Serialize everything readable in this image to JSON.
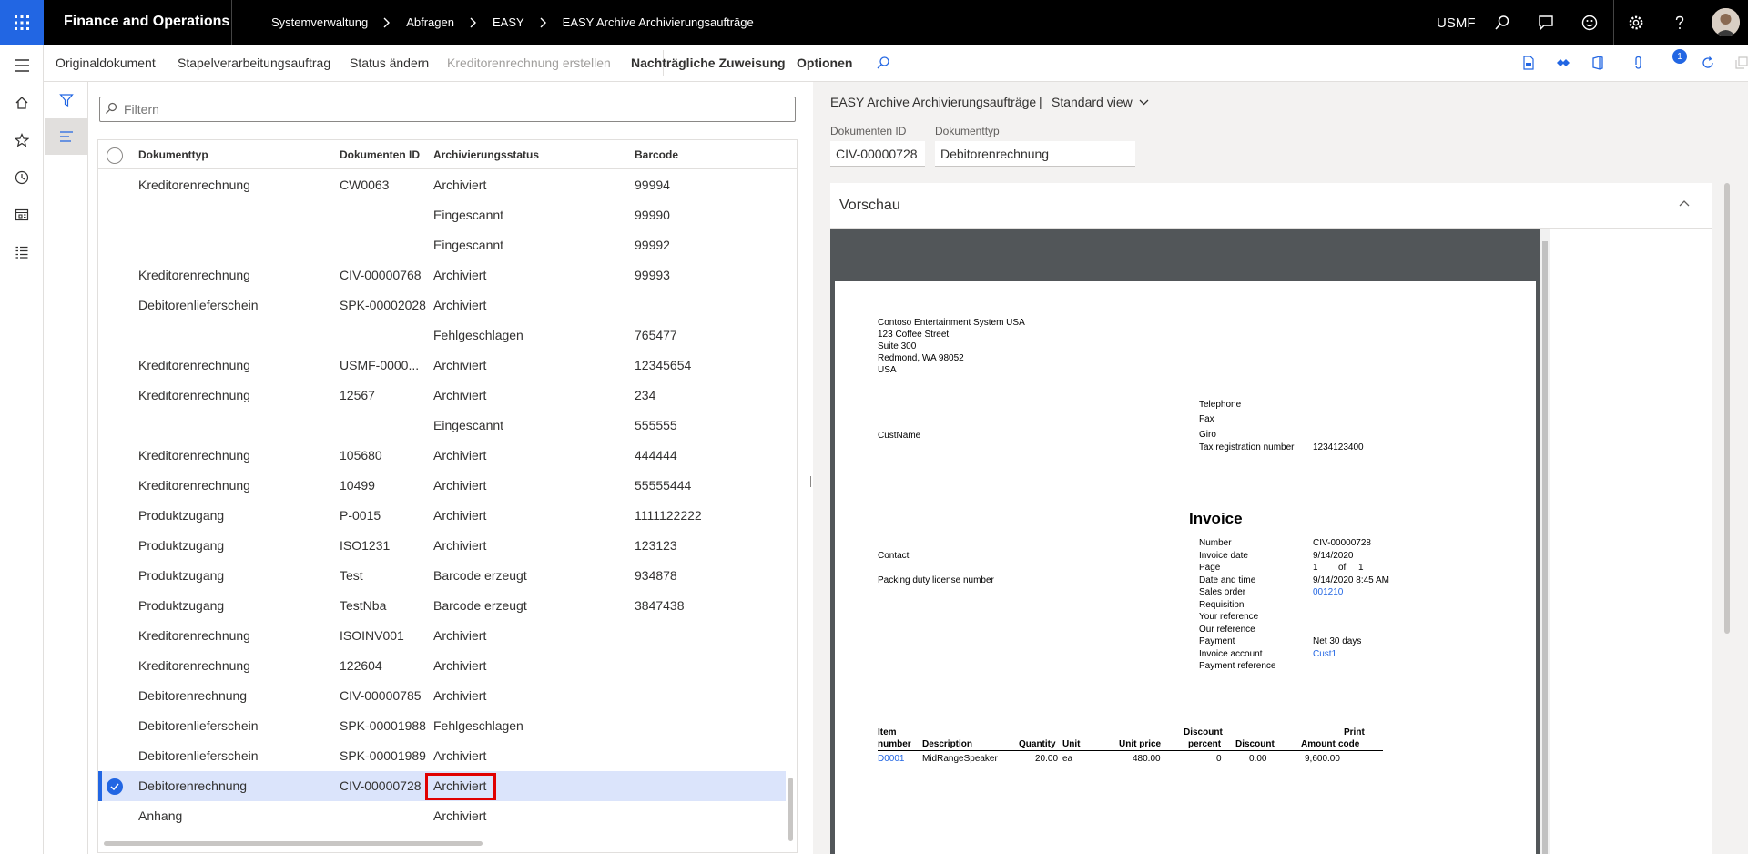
{
  "topbar": {
    "app_title": "Finance and Operations",
    "breadcrumb": [
      "Systemverwaltung",
      "Abfragen",
      "EASY",
      "EASY Archive Archivierungsaufträge"
    ],
    "company": "USMF",
    "icons": [
      "search-icon",
      "message-icon",
      "smiley-icon",
      "gear-icon",
      "help-icon"
    ]
  },
  "actionbar": {
    "items": [
      "Originaldokument",
      "Stapelverarbeitungsauftrag",
      "Status ändern",
      "Kreditorenrechnung erstellen",
      "Nachträgliche Zuweisung",
      "Optionen"
    ],
    "disabled": [
      "Kreditorenrechnung erstellen"
    ],
    "badge_count": "1"
  },
  "list": {
    "filter_placeholder": "Filtern",
    "columns": [
      "Dokumenttyp",
      "Dokumenten ID",
      "Archivierungsstatus",
      "Barcode"
    ],
    "rows": [
      {
        "type": "Kreditorenrechnung",
        "id": "CW0063",
        "status": "Archiviert",
        "barcode": "99994"
      },
      {
        "type": "",
        "id": "",
        "status": "Eingescannt",
        "barcode": "99990"
      },
      {
        "type": "",
        "id": "",
        "status": "Eingescannt",
        "barcode": "99992"
      },
      {
        "type": "Kreditorenrechnung",
        "id": "CIV-00000768",
        "status": "Archiviert",
        "barcode": "99993"
      },
      {
        "type": "Debitorenlieferschein",
        "id": "SPK-00002028",
        "status": "Archiviert",
        "barcode": ""
      },
      {
        "type": "",
        "id": "",
        "status": "Fehlgeschlagen",
        "barcode": "765477"
      },
      {
        "type": "Kreditorenrechnung",
        "id": "USMF-0000...",
        "status": "Archiviert",
        "barcode": "12345654"
      },
      {
        "type": "Kreditorenrechnung",
        "id": "12567",
        "status": "Archiviert",
        "barcode": "234"
      },
      {
        "type": "",
        "id": "",
        "status": "Eingescannt",
        "barcode": "555555"
      },
      {
        "type": "Kreditorenrechnung",
        "id": "105680",
        "status": "Archiviert",
        "barcode": "444444"
      },
      {
        "type": "Kreditorenrechnung",
        "id": "10499",
        "status": "Archiviert",
        "barcode": "55555444"
      },
      {
        "type": "Produktzugang",
        "id": "P-0015",
        "status": "Archiviert",
        "barcode": "1111122222"
      },
      {
        "type": "Produktzugang",
        "id": "ISO1231",
        "status": "Archiviert",
        "barcode": "123123"
      },
      {
        "type": "Produktzugang",
        "id": "Test",
        "status": "Barcode erzeugt",
        "barcode": "934878"
      },
      {
        "type": "Produktzugang",
        "id": "TestNba",
        "status": "Barcode erzeugt",
        "barcode": "3847438"
      },
      {
        "type": "Kreditorenrechnung",
        "id": "ISOINV001",
        "status": "Archiviert",
        "barcode": ""
      },
      {
        "type": "Kreditorenrechnung",
        "id": "122604",
        "status": "Archiviert",
        "barcode": ""
      },
      {
        "type": "Debitorenrechnung",
        "id": "CIV-00000785",
        "status": "Archiviert",
        "barcode": ""
      },
      {
        "type": "Debitorenlieferschein",
        "id": "SPK-00001988",
        "status": "Fehlgeschlagen",
        "barcode": ""
      },
      {
        "type": "Debitorenlieferschein",
        "id": "SPK-00001989",
        "status": "Archiviert",
        "barcode": ""
      },
      {
        "type": "Debitorenrechnung",
        "id": "CIV-00000728",
        "status": "Archiviert",
        "barcode": "",
        "selected": true
      },
      {
        "type": "Anhang",
        "id": "",
        "status": "Archiviert",
        "barcode": ""
      }
    ]
  },
  "detail": {
    "title": "EASY Archive Archivierungsaufträge",
    "separator": "|",
    "view": "Standard view",
    "doc_id_label": "Dokumenten ID",
    "doc_id_value": "CIV-00000728",
    "doc_type_label": "Dokumenttyp",
    "doc_type_value": "Debitorenrechnung",
    "preview_title": "Vorschau"
  },
  "invoice": {
    "company_lines": [
      "Contoso Entertainment System USA",
      "123 Coffee Street",
      "Suite 300",
      "Redmond, WA 98052",
      "USA"
    ],
    "contact_labels": [
      "Telephone",
      "Fax",
      "Giro",
      "Tax registration number"
    ],
    "tax_number": "1234123400",
    "cust_name": "CustName",
    "title": "Invoice",
    "contact": "Contact",
    "packing": "Packing duty license number",
    "info_labels": [
      "Number",
      "Invoice date",
      "Page",
      "Date and time",
      "Sales order",
      "Requisition",
      "Your reference",
      "Our reference",
      "Payment",
      "Invoice account",
      "Payment reference"
    ],
    "info_values": {
      "number": "CIV-00000728",
      "date": "9/14/2020",
      "page_a": "1",
      "page_of": "of",
      "page_b": "1",
      "datetime": "9/14/2020 8:45 AM",
      "sales_order": "001210",
      "payment": "Net 30 days",
      "account": "Cust1"
    },
    "table_headers": {
      "item_1": "Item",
      "item_2": "number",
      "description": "Description",
      "quantity": "Quantity",
      "unit": "Unit",
      "unit_price": "Unit price",
      "disc_pct_1": "Discount",
      "disc_pct_2": "percent",
      "discount": "Discount",
      "amount": "Amount",
      "print_1": "Print",
      "print_2": "code"
    },
    "line": {
      "item": "D0001",
      "description": "MidRangeSpeaker",
      "quantity": "20.00",
      "unit": "ea",
      "unit_price": "480.00",
      "disc_pct": "0",
      "discount": "0.00",
      "amount": "9,600.00"
    }
  }
}
